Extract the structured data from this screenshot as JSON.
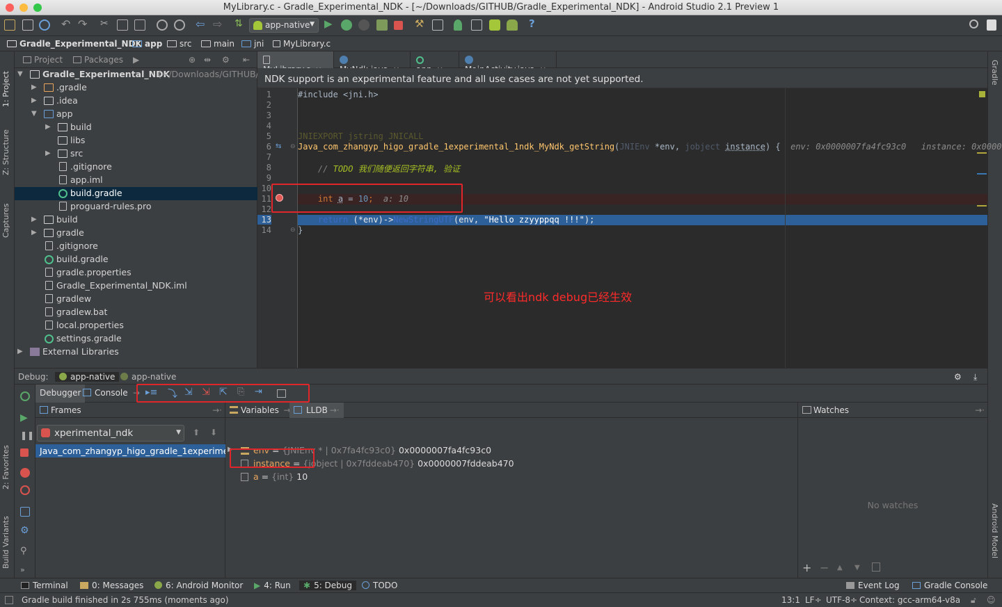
{
  "window": {
    "title": "MyLibrary.c - Gradle_Experimental_NDK - [~/Downloads/GITHUB/Gradle_Experimental_NDK] - Android Studio 2.1 Preview 1"
  },
  "toolbar": {
    "run_config": "app-native"
  },
  "breadcrumb": [
    "Gradle_Experimental_NDK",
    "app",
    "src",
    "main",
    "jni",
    "MyLibrary.c"
  ],
  "left_stripe": [
    "1: Project",
    "Z: Structure",
    "Captures",
    "2: Favorites",
    "Build Variants"
  ],
  "right_stripe": [
    "Gradle",
    "Android Model"
  ],
  "project": {
    "tabs": [
      "Project",
      "Packages"
    ],
    "tree": [
      {
        "label": "Gradle_Experimental_NDK",
        "path": "(~/Downloads/GITHUB/G"
      },
      {
        "label": ".gradle"
      },
      {
        "label": ".idea"
      },
      {
        "label": "app"
      },
      {
        "label": "build"
      },
      {
        "label": "libs"
      },
      {
        "label": "src"
      },
      {
        "label": ".gitignore"
      },
      {
        "label": "app.iml"
      },
      {
        "label": "build.gradle"
      },
      {
        "label": "proguard-rules.pro"
      },
      {
        "label": "build"
      },
      {
        "label": "gradle"
      },
      {
        "label": ".gitignore"
      },
      {
        "label": "build.gradle"
      },
      {
        "label": "gradle.properties"
      },
      {
        "label": "Gradle_Experimental_NDK.iml"
      },
      {
        "label": "gradlew"
      },
      {
        "label": "gradlew.bat"
      },
      {
        "label": "local.properties"
      },
      {
        "label": "settings.gradle"
      },
      {
        "label": "External Libraries"
      }
    ]
  },
  "editor": {
    "tabs": [
      "MyLibrary.c",
      "MyNdk.java",
      "app",
      "MainActivity.java"
    ],
    "notice": "NDK support is an experimental feature and all use cases are not yet supported.",
    "line_numbers": [
      "1",
      "2",
      "3",
      "4",
      "5",
      "6",
      "7",
      "8",
      "9",
      "10",
      "11",
      "12",
      "13",
      "14"
    ],
    "code": {
      "l1": "#include <jni.h>",
      "l5_a": "JNIEXPORT",
      "l5_b": "jstring",
      "l5_c": "JNICALL",
      "l6_fn": "Java_com_zhangyp_higo_gradle_1experimental_1ndk_MyNdk_getString",
      "l6_t1": "JNIEnv",
      "l6_p1": "*env,",
      "l6_t2": "jobject",
      "l6_p2": "instance",
      "l6_end": ") {",
      "l6_hint": "env: 0x0000007fa4fc93c0   instance: 0x0000007",
      "l8_a": "// ",
      "l8_b": "TODO 我们随便返回字符串, 验证",
      "l11_kw": "int",
      "l11_var": "a",
      "l11_eq": " = ",
      "l11_num": "10",
      "l11_semi": ";",
      "l11_hint": "a: 10",
      "l13_ret": "return",
      "l13_a": "(*env)->",
      "l13_fn": "NewStringUTF",
      "l13_b": "(env, ",
      "l13_str": "\"Hello zzyyppqq !!!\"",
      "l13_c": ");",
      "l14": "}"
    },
    "annotation": "可以看出ndk debug已经生效"
  },
  "debug": {
    "label": "Debug:",
    "sessions": [
      "app-native",
      "app-native"
    ],
    "tabs": [
      "Debugger",
      "Console"
    ],
    "frames_title": "Frames",
    "thread": "xperimental_ndk",
    "frame": "Java_com_zhangyp_higo_gradle_1experiment",
    "variables_title": "Variables",
    "lldb_title": "LLDB",
    "variables": [
      {
        "name": "env",
        "type": "{JNIEnv * | 0x7fa4fc93c0}",
        "value": "0x0000007fa4fc93c0"
      },
      {
        "name": "instance",
        "type": "{jobject | 0x7fddeab470}",
        "value": "0x0000007fddeab470"
      },
      {
        "name": "a",
        "type": "{int}",
        "value": "10"
      }
    ],
    "watches_title": "Watches",
    "no_watches": "No watches"
  },
  "bottom_tabs": [
    "Terminal",
    "0: Messages",
    "6: Android Monitor",
    "4: Run",
    "5: Debug",
    "TODO",
    "Event Log",
    "Gradle Console"
  ],
  "status": {
    "message": "Gradle build finished in 2s 755ms (moments ago)",
    "position": "13:1",
    "line_sep": "LF÷",
    "encoding": "UTF-8÷",
    "context": "Context: gcc-arm64-v8a"
  },
  "colors": {
    "accent_selection": "#2d6099",
    "annotation": "#ff2b2b",
    "highlight_box": "#e0252b"
  }
}
